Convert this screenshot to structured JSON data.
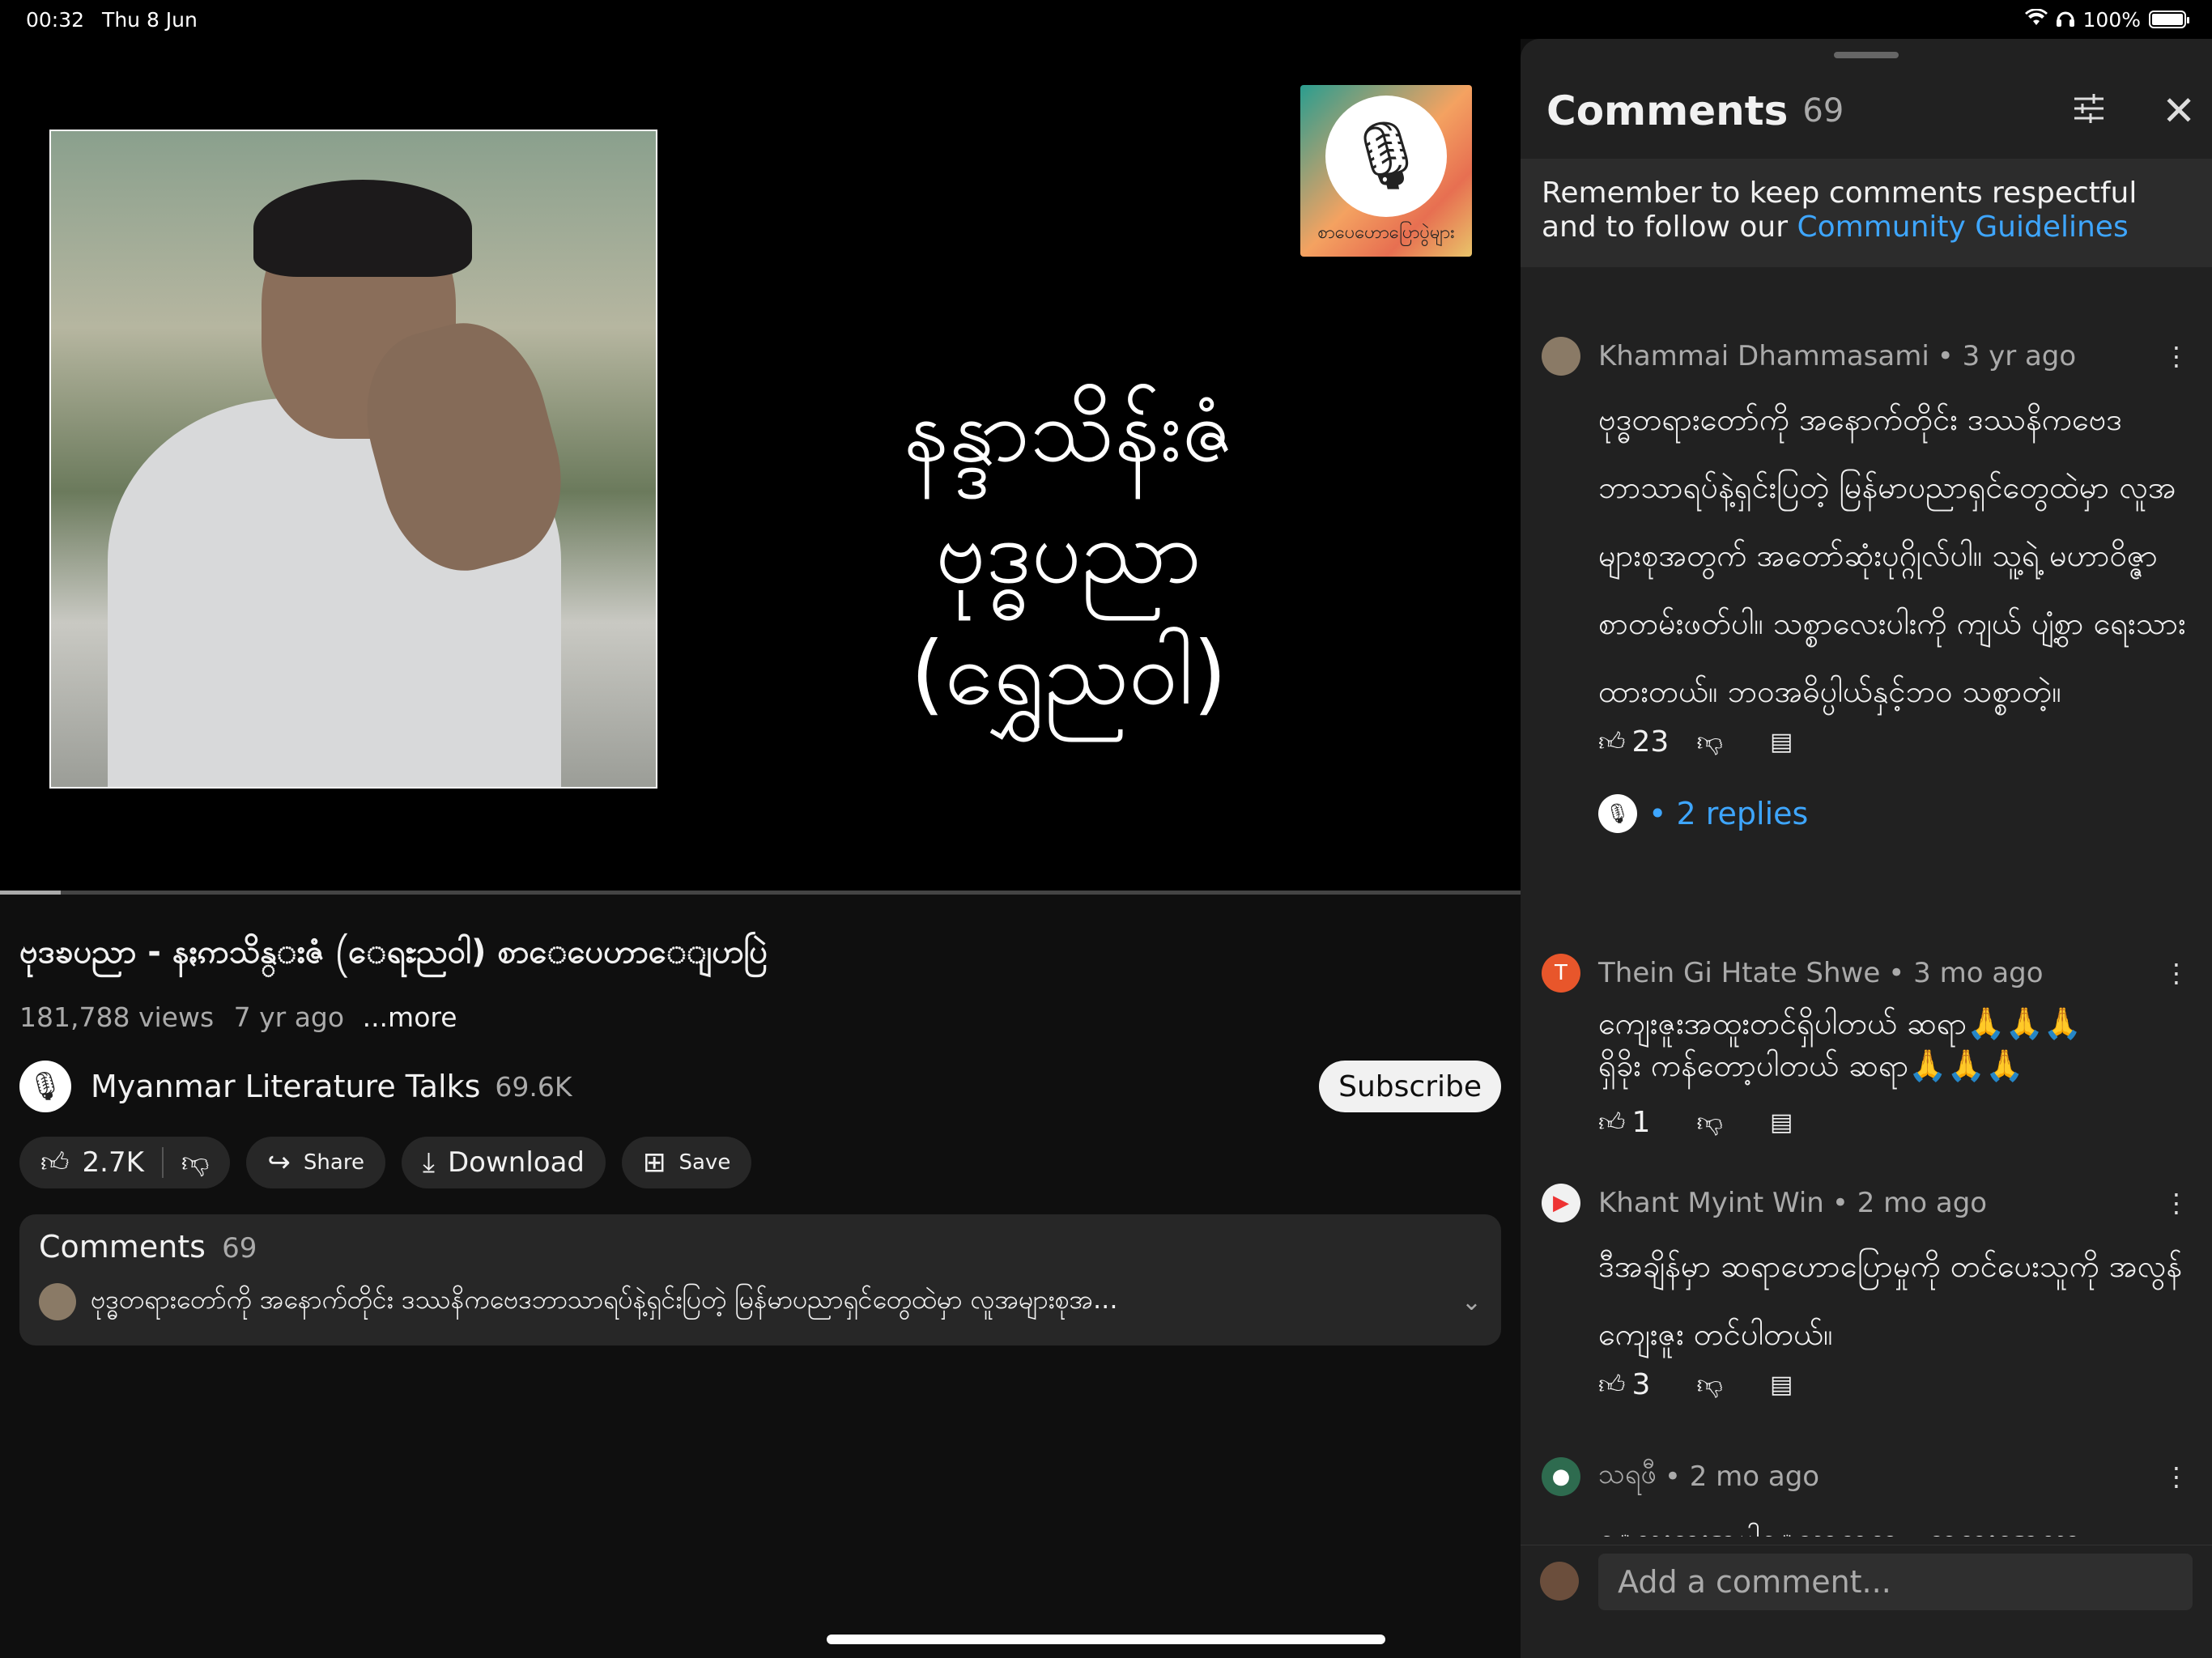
{
  "status": {
    "time": "00:32",
    "date": "Thu 8 Jun",
    "wifi_icon": "wifi-icon",
    "headphones_icon": "headphones-icon",
    "battery": "100%"
  },
  "player": {
    "overlay_line1": "နန္ဒာသိန်းဇံ",
    "overlay_line2": "ဗုဒ္ဓပညာ",
    "overlay_line3": "(ရွှေညဝါ)",
    "badge_caption": "စာပေဟောပြောပွဲများ",
    "progress_fraction": 0.04
  },
  "video": {
    "title": "ဗုဒၶပညာ - နႏၵာသိန္းဇံ (ေရႊညဝါ) စာေပေဟာေျပာပြဲ",
    "views": "181,788 views",
    "age": "7 yr ago",
    "more": "...more",
    "channel_name": "Myanmar Literature Talks",
    "subscribers": "69.6K",
    "subscribe_label": "Subscribe",
    "likes": "2.7K",
    "share_label": "Share",
    "download_label": "Download",
    "save_label": "Save"
  },
  "comments_card": {
    "title": "Comments",
    "count": "69",
    "preview": "ဗုဒ္ဓတရားတော်ကို အနောက်တိုင်း ဒဿနိကဗေဒဘာသာရပ်နဲ့ရှင်းပြတဲ့ မြန်မာပညာရှင်တွေထဲမှာ လူအများစုအ..."
  },
  "panel": {
    "title": "Comments",
    "count": "69",
    "notice_text": "Remember to keep comments respectful and to follow our ",
    "notice_link": "Community Guidelines",
    "add_placeholder": "Add a comment...",
    "comments": [
      {
        "author": "Khammai Dhammasami",
        "age": "• 3 yr ago",
        "text": "ဗုဒ္ဓတရားတော်ကို အနောက်တိုင်း ဒဿနိကဗေဒ ဘာသာရပ်နဲ့ရှင်းပြတဲ့ မြန်မာပညာရှင်တွေထဲမှာ လူအများစုအတွက် အတော်ဆုံးပုဂ္ဂိုလ်ပါ။ သူ့ရဲ့ မဟာဝိဇ္ဇာစာတမ်းဖတ်ပါ။ သစ္စာလေးပါးကို ကျယ် ပျံ့စွာ ရေးသားထားတယ်။ ဘဝအဓိပ္ပါယ်နှင့်ဘဝ သစ္စာတဲ့။",
        "likes": "23",
        "replies": "• 2 replies"
      },
      {
        "author": "Thein Gi Htate Shwe",
        "avatar_letter": "T",
        "age": "• 3 mo ago",
        "text_line1": "ကျေးဇူးအထူးတင်ရှိပါတယ် ဆရာ🙏🙏🙏",
        "text_line2": "ရှိခိုး ကန်တော့ပါတယ် ဆရာ🙏🙏🙏",
        "likes": "1"
      },
      {
        "author": "Khant Myint Win",
        "age": "• 2 mo ago",
        "text": "ဒီအချိန်မှာ ဆရာဟောပြောမှုကို တင်ပေးသူကို အလွန်ကျေးဇူး တင်ပါတယ်။",
        "likes": "3"
      },
      {
        "author": "သရဖီ",
        "age": "• 2 mo ago",
        "text": "ေလးစားအပ္ပါေသာဆရာ...ဘုရားအေလာ"
      }
    ]
  }
}
